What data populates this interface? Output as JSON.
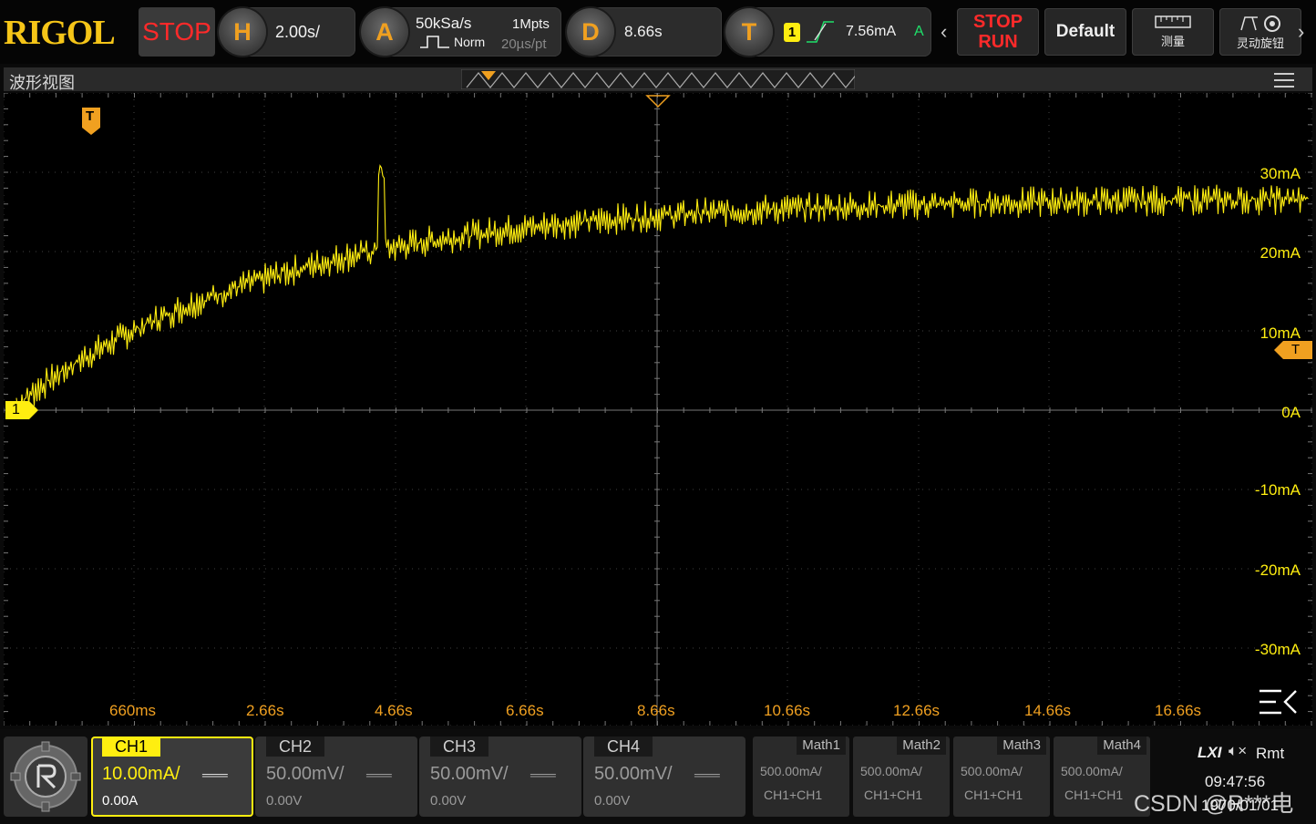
{
  "brand": "RIGOL",
  "top": {
    "state": "STOP",
    "horizontal": {
      "key": "H",
      "timebase": "2.00s/"
    },
    "acquire": {
      "key": "A",
      "sample_rate": "50kSa/s",
      "memory_depth": "1Mpts",
      "mode": "Norm",
      "time_per_point": "20µs/pt"
    },
    "delay": {
      "key": "D",
      "value": "8.66s"
    },
    "trigger": {
      "key": "T",
      "source": "1",
      "level": "7.56mA",
      "mode": "A"
    },
    "run_stop": {
      "line1": "STOP",
      "line2": "RUN"
    },
    "default_label": "Default",
    "measure_label": "测量",
    "knob_label": "灵动旋钮"
  },
  "view_title": "波形视图",
  "trace": {
    "channel_marker": "1",
    "trigger_marker": "T",
    "color": "#ffee10",
    "y_labels": [
      "30mA",
      "20mA",
      "10mA",
      "0A",
      "-10mA",
      "-20mA",
      "-30mA"
    ],
    "x_labels": [
      "660ms",
      "2.66s",
      "4.66s",
      "6.66s",
      "8.66s",
      "10.66s",
      "12.66s",
      "14.66s",
      "16.66s"
    ]
  },
  "channels": [
    {
      "name": "CH1",
      "scale": "10.00mA/",
      "offset": "0.00A",
      "active": true
    },
    {
      "name": "CH2",
      "scale": "50.00mV/",
      "offset": "0.00V",
      "active": false
    },
    {
      "name": "CH3",
      "scale": "50.00mV/",
      "offset": "0.00V",
      "active": false
    },
    {
      "name": "CH4",
      "scale": "50.00mV/",
      "offset": "0.00V",
      "active": false
    }
  ],
  "maths": [
    {
      "name": "Math1",
      "scale": "500.00mA/",
      "source": "CH1+CH1"
    },
    {
      "name": "Math2",
      "scale": "500.00mA/",
      "source": "CH1+CH1"
    },
    {
      "name": "Math3",
      "scale": "500.00mA/",
      "source": "CH1+CH1"
    },
    {
      "name": "Math4",
      "scale": "500.00mA/",
      "source": "CH1+CH1"
    }
  ],
  "status": {
    "lxi": "LXI",
    "remote": "Rmt",
    "time": "09:47:56",
    "date": "1970/01/01"
  },
  "watermark": "CSDN @R***电",
  "colors": {
    "accent": "#f0a020",
    "stop_red": "#ff2a2a",
    "trace": "#ffee10"
  }
}
